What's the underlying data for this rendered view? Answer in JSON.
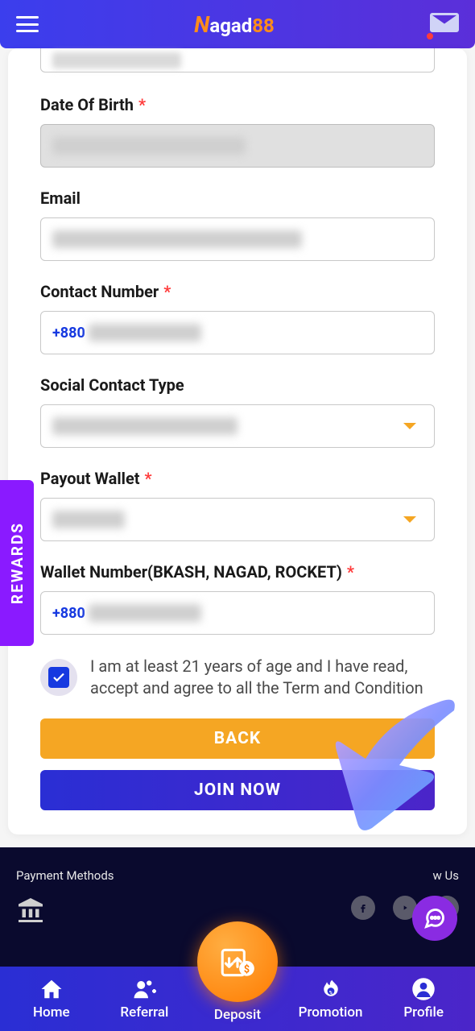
{
  "header": {
    "logo_n": "N",
    "logo_agad": "agad",
    "logo_88": "88"
  },
  "rewards_tab": "REWARDS",
  "form": {
    "dob_label": "Date Of Birth",
    "email_label": "Email",
    "contact_label": "Contact Number",
    "social_label": "Social Contact Type",
    "payout_label": "Payout Wallet",
    "wallet_label": "Wallet Number(BKASH, NAGAD, ROCKET)",
    "phone_prefix": "+880",
    "terms_text": "I am at least 21 years of age and I have read, accept and agree to all the Term and Condition",
    "back_btn": "BACK",
    "join_btn": "JOIN NOW"
  },
  "footer": {
    "payment_label": "Payment Methods",
    "follow_label": "w Us"
  },
  "nav": {
    "home": "Home",
    "referral": "Referral",
    "deposit": "Deposit",
    "promotion": "Promotion",
    "profile": "Profile"
  }
}
